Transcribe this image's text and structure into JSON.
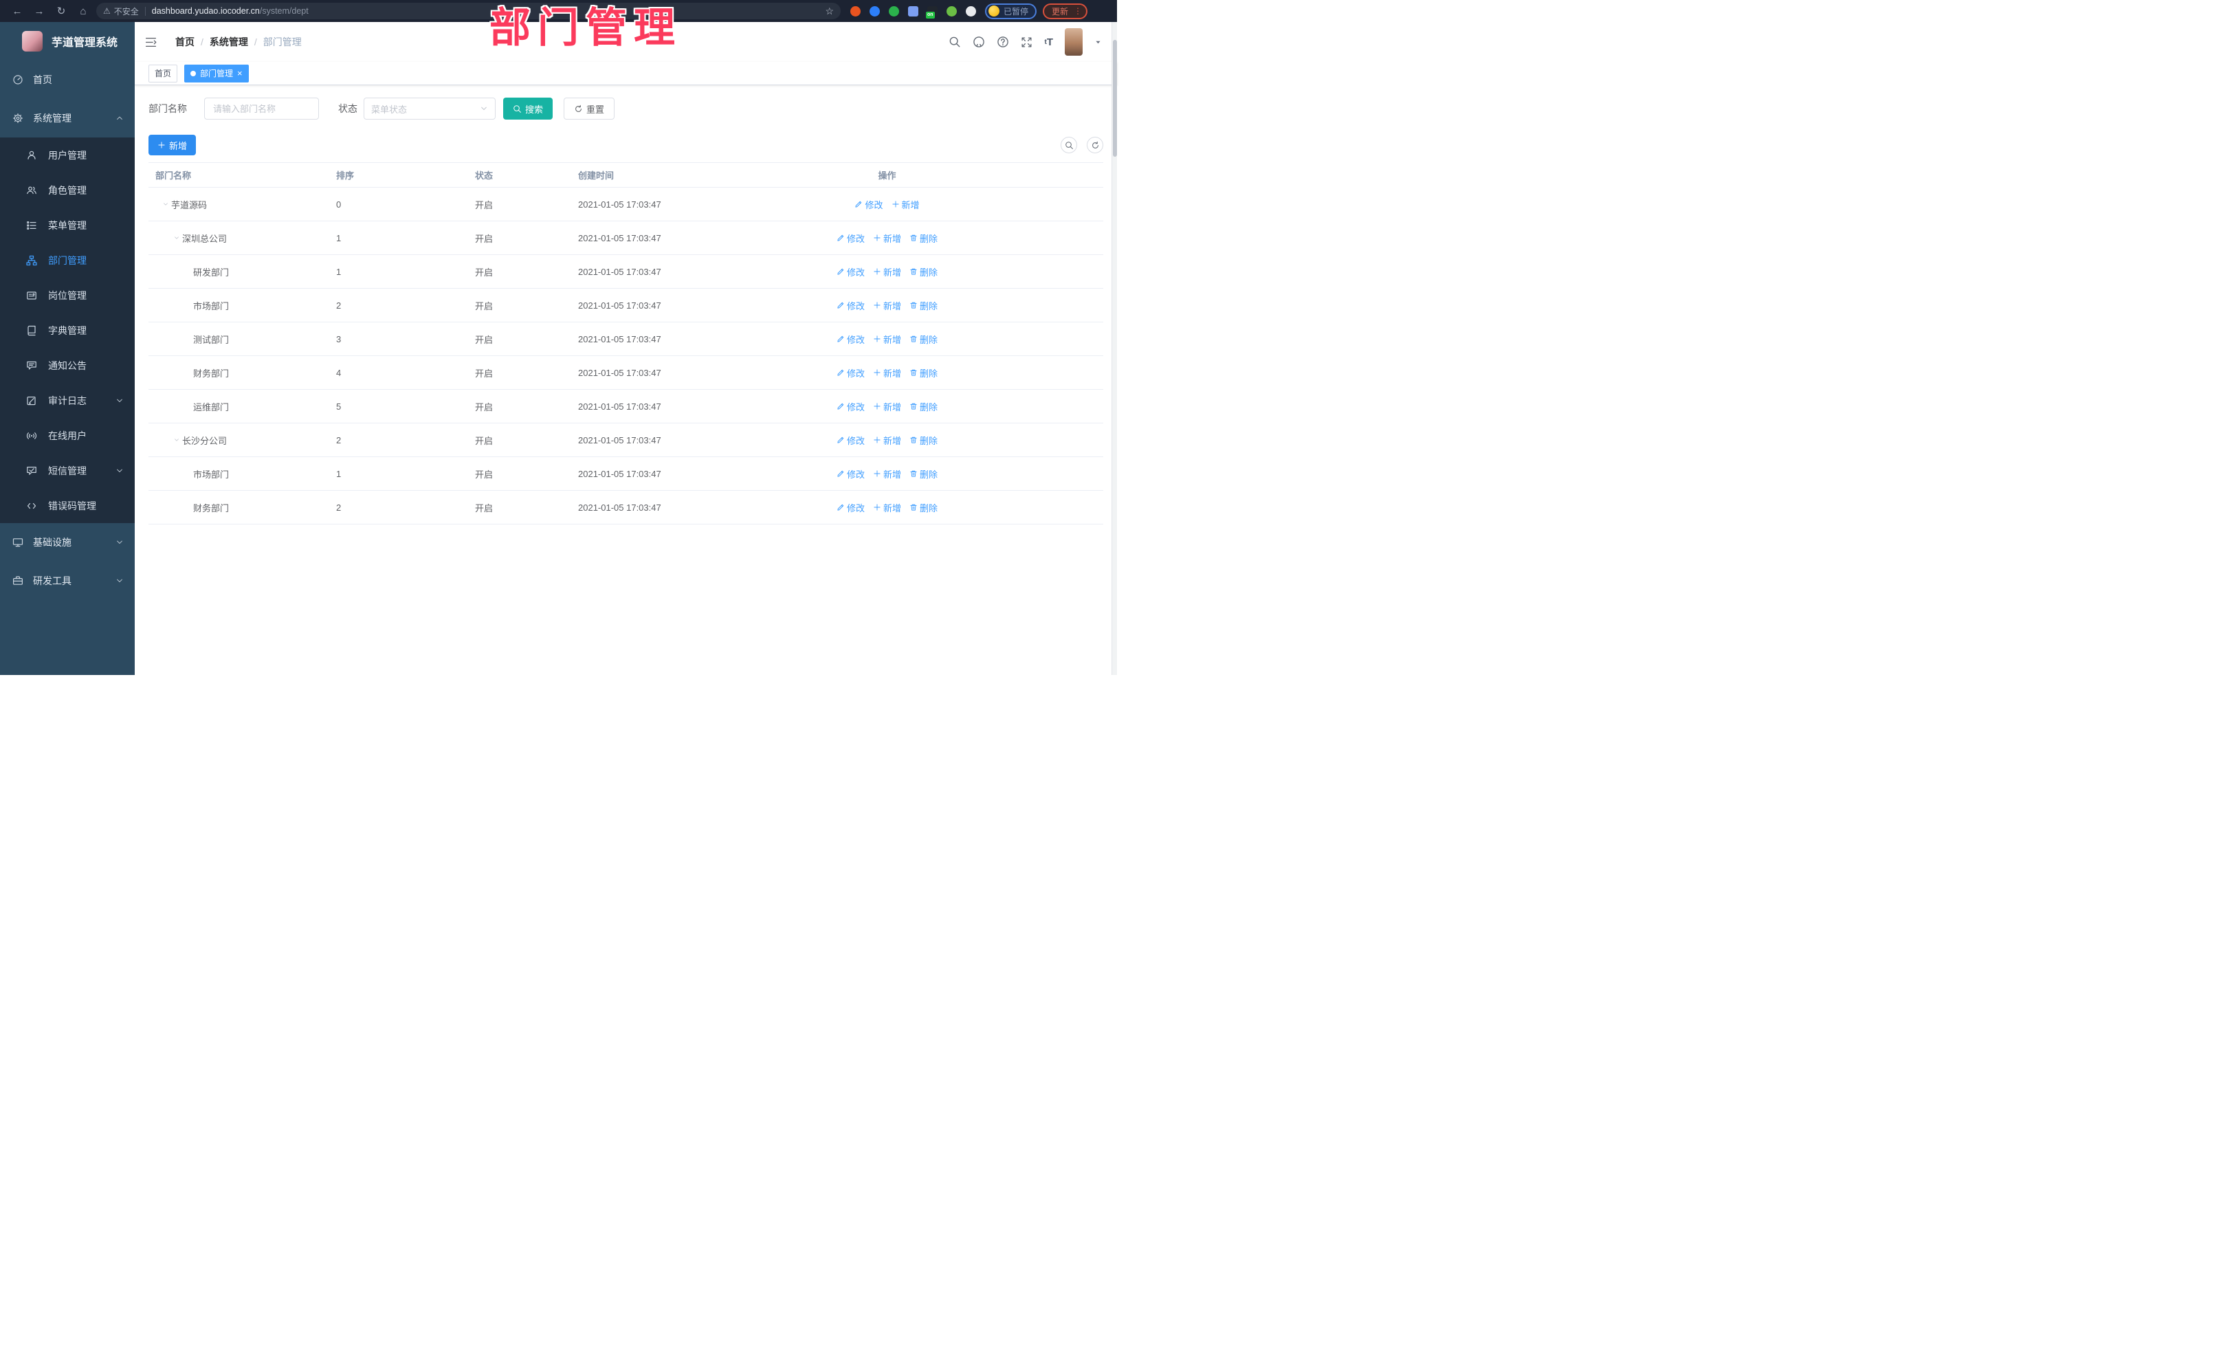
{
  "chrome": {
    "nav_icons": [
      "back",
      "forward",
      "reload",
      "home"
    ],
    "security_label": "不安全",
    "url_host": "dashboard.yudao.iocoder.cn",
    "url_path": "/system/dept",
    "extensions": [
      {
        "name": "ubuntu-extension",
        "color": "#E95420",
        "shape": "circle"
      },
      {
        "name": "blue-drop-extension",
        "color": "#2D7FF9",
        "shape": "circle"
      },
      {
        "name": "green-check-extension",
        "color": "#2BB24C",
        "shape": "circle"
      },
      {
        "name": "grid-extension",
        "color": "#7C9FF2",
        "shape": "square"
      },
      {
        "name": "proxy-extension",
        "color": "#20262E",
        "shape": "square",
        "badge": "on",
        "badge_color": "#23C343"
      },
      {
        "name": "green-tool-extension",
        "color": "#6BBE45",
        "shape": "circle"
      },
      {
        "name": "puzzle-extension",
        "color": "#E8EAED",
        "shape": "circle"
      }
    ],
    "profile_status": "已暂停",
    "update_label": "更新"
  },
  "watermark": {
    "text": "部门管理"
  },
  "sidebar": {
    "app_title": "芋道管理系统",
    "items": [
      {
        "id": "home",
        "label": "首页",
        "icon": "dashboard",
        "kind": "top"
      },
      {
        "id": "system",
        "label": "系统管理",
        "icon": "gear",
        "kind": "top",
        "chevron": "up"
      },
      {
        "id": "user",
        "label": "用户管理",
        "icon": "user",
        "kind": "sub"
      },
      {
        "id": "role",
        "label": "角色管理",
        "icon": "users",
        "kind": "sub"
      },
      {
        "id": "menu",
        "label": "菜单管理",
        "icon": "menu",
        "kind": "sub"
      },
      {
        "id": "dept",
        "label": "部门管理",
        "icon": "dept",
        "kind": "sub",
        "active": true
      },
      {
        "id": "post",
        "label": "岗位管理",
        "icon": "post",
        "kind": "sub"
      },
      {
        "id": "dict",
        "label": "字典管理",
        "icon": "dict",
        "kind": "sub"
      },
      {
        "id": "notice",
        "label": "通知公告",
        "icon": "notice",
        "kind": "sub"
      },
      {
        "id": "audit",
        "label": "审计日志",
        "icon": "audit",
        "kind": "sub",
        "chevron": "down"
      },
      {
        "id": "online",
        "label": "在线用户",
        "icon": "online",
        "kind": "sub"
      },
      {
        "id": "sms",
        "label": "短信管理",
        "icon": "sms",
        "kind": "sub",
        "chevron": "down"
      },
      {
        "id": "errcode",
        "label": "错误码管理",
        "icon": "errcode",
        "kind": "sub"
      },
      {
        "id": "infra",
        "label": "基础设施",
        "icon": "infra",
        "kind": "top",
        "chevron": "down"
      },
      {
        "id": "tool",
        "label": "研发工具",
        "icon": "tool",
        "kind": "top",
        "chevron": "down"
      }
    ]
  },
  "header": {
    "breadcrumb": [
      {
        "label": "首页"
      },
      {
        "label": "系统管理"
      },
      {
        "label": "部门管理",
        "current": true
      }
    ],
    "icons": [
      "search",
      "github",
      "help",
      "fullscreen",
      "font-size",
      "avatar",
      "caret-down"
    ]
  },
  "tabs": [
    {
      "label": "首页",
      "active": false
    },
    {
      "label": "部门管理",
      "active": true,
      "closable": true
    }
  ],
  "filters": {
    "dept_label": "部门名称",
    "dept_placeholder": "请输入部门名称",
    "status_label": "状态",
    "status_placeholder": "菜单状态",
    "search_label": "搜索",
    "reset_label": "重置"
  },
  "toolbar": {
    "add_label": "新增"
  },
  "table": {
    "columns": [
      "部门名称",
      "排序",
      "状态",
      "创建时间",
      "操作"
    ],
    "rows": [
      {
        "name": "芋道源码",
        "level": 0,
        "expandable": true,
        "sort": "0",
        "status": "开启",
        "created": "2021-01-05 17:03:47",
        "actions": [
          {
            "type": "edit",
            "label": "修改"
          },
          {
            "type": "add",
            "label": "新增"
          }
        ]
      },
      {
        "name": "深圳总公司",
        "level": 1,
        "expandable": true,
        "sort": "1",
        "status": "开启",
        "created": "2021-01-05 17:03:47",
        "actions": [
          {
            "type": "edit",
            "label": "修改"
          },
          {
            "type": "add",
            "label": "新增"
          },
          {
            "type": "delete",
            "label": "删除"
          }
        ]
      },
      {
        "name": "研发部门",
        "level": 2,
        "expandable": false,
        "sort": "1",
        "status": "开启",
        "created": "2021-01-05 17:03:47",
        "actions": [
          {
            "type": "edit",
            "label": "修改"
          },
          {
            "type": "add",
            "label": "新增"
          },
          {
            "type": "delete",
            "label": "删除"
          }
        ]
      },
      {
        "name": "市场部门",
        "level": 2,
        "expandable": false,
        "sort": "2",
        "status": "开启",
        "created": "2021-01-05 17:03:47",
        "actions": [
          {
            "type": "edit",
            "label": "修改"
          },
          {
            "type": "add",
            "label": "新增"
          },
          {
            "type": "delete",
            "label": "删除"
          }
        ]
      },
      {
        "name": "测试部门",
        "level": 2,
        "expandable": false,
        "sort": "3",
        "status": "开启",
        "created": "2021-01-05 17:03:47",
        "actions": [
          {
            "type": "edit",
            "label": "修改"
          },
          {
            "type": "add",
            "label": "新增"
          },
          {
            "type": "delete",
            "label": "删除"
          }
        ]
      },
      {
        "name": "财务部门",
        "level": 2,
        "expandable": false,
        "sort": "4",
        "status": "开启",
        "created": "2021-01-05 17:03:47",
        "actions": [
          {
            "type": "edit",
            "label": "修改"
          },
          {
            "type": "add",
            "label": "新增"
          },
          {
            "type": "delete",
            "label": "删除"
          }
        ]
      },
      {
        "name": "运维部门",
        "level": 2,
        "expandable": false,
        "sort": "5",
        "status": "开启",
        "created": "2021-01-05 17:03:47",
        "actions": [
          {
            "type": "edit",
            "label": "修改"
          },
          {
            "type": "add",
            "label": "新增"
          },
          {
            "type": "delete",
            "label": "删除"
          }
        ]
      },
      {
        "name": "长沙分公司",
        "level": 1,
        "expandable": true,
        "sort": "2",
        "status": "开启",
        "created": "2021-01-05 17:03:47",
        "actions": [
          {
            "type": "edit",
            "label": "修改"
          },
          {
            "type": "add",
            "label": "新增"
          },
          {
            "type": "delete",
            "label": "删除"
          }
        ]
      },
      {
        "name": "市场部门",
        "level": 2,
        "expandable": false,
        "sort": "1",
        "status": "开启",
        "created": "2021-01-05 17:03:47",
        "actions": [
          {
            "type": "edit",
            "label": "修改"
          },
          {
            "type": "add",
            "label": "新增"
          },
          {
            "type": "delete",
            "label": "删除"
          }
        ]
      },
      {
        "name": "财务部门",
        "level": 2,
        "expandable": false,
        "sort": "2",
        "status": "开启",
        "created": "2021-01-05 17:03:47",
        "actions": [
          {
            "type": "edit",
            "label": "修改"
          },
          {
            "type": "add",
            "label": "新增"
          },
          {
            "type": "delete",
            "label": "删除"
          }
        ]
      }
    ]
  },
  "colors": {
    "primary": "#409EFF",
    "add_button": "#2D8CF0",
    "search_button": "#17B3A3",
    "sidebar_bg": "#2C4A60",
    "submenu_bg": "#1F2D3D",
    "chrome_bg": "#1C2332",
    "tab_active": "#409EFF",
    "watermark": "#FB3A5C",
    "row_border": "#EBEEF5"
  }
}
